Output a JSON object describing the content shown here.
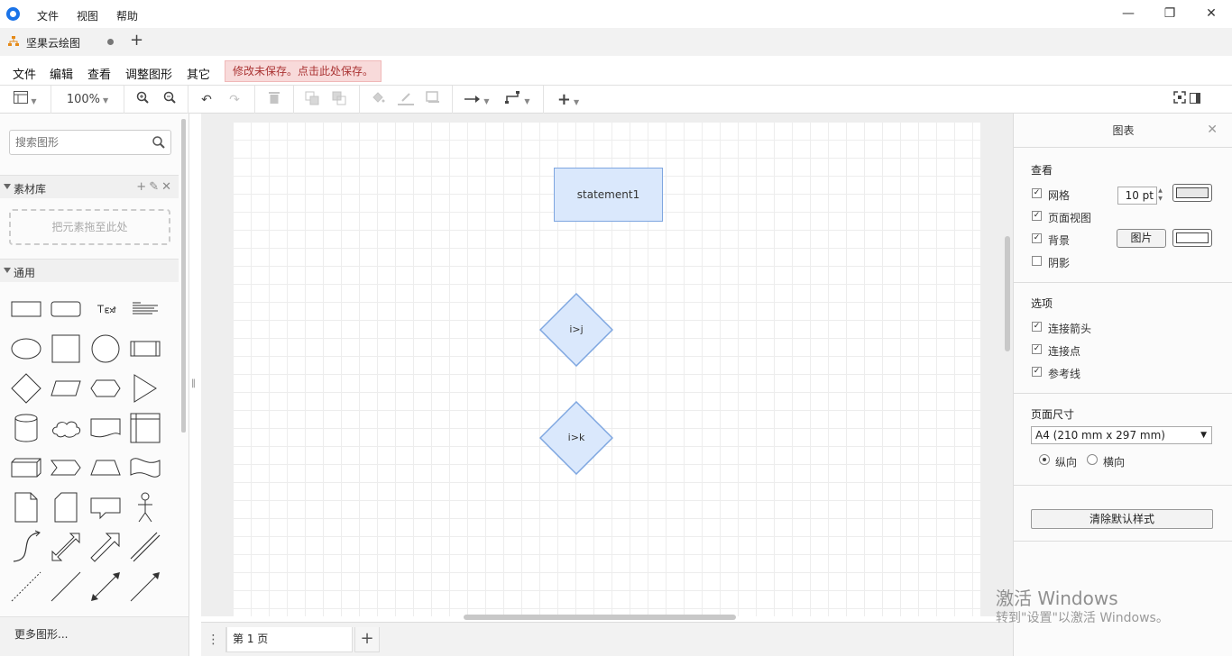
{
  "titlebar": {
    "menus": [
      "文件",
      "视图",
      "帮助"
    ],
    "minimize": "—",
    "restore": "❐",
    "close": "✕"
  },
  "tabbar": {
    "doc_title": "坚果云绘图",
    "new_tab": "+"
  },
  "menubar": {
    "items": [
      "文件",
      "编辑",
      "查看",
      "调整图形",
      "其它"
    ],
    "unsaved_notice": "修改未保存。点击此处保存。"
  },
  "toolbar": {
    "zoom": "100%"
  },
  "sidebar": {
    "search_placeholder": "搜索图形",
    "library_title": "素材库",
    "drop_zone": "把元素拖至此处",
    "general_title": "通用",
    "more_shapes": "更多图形..."
  },
  "canvas": {
    "nodes": [
      {
        "label": "statement1"
      },
      {
        "label": "i>j"
      },
      {
        "label": "i>k"
      }
    ]
  },
  "pagebar": {
    "page_name": "第 1 页",
    "menu": "⋮",
    "add": "+"
  },
  "panel": {
    "title": "图表",
    "view_title": "查看",
    "grid": "网格",
    "grid_size": "10 pt",
    "page_view": "页面视图",
    "background": "背景",
    "image_button": "图片",
    "shadow": "阴影",
    "options_title": "选项",
    "connect_arrows": "连接箭头",
    "connect_points": "连接点",
    "guides": "参考线",
    "page_size_title": "页面尺寸",
    "page_size_value": "A4 (210 mm x 297 mm)",
    "portrait": "纵向",
    "landscape": "横向",
    "clear_style": "清除默认样式"
  },
  "watermark": {
    "line1": "激活 Windows",
    "line2": "转到\"设置\"以激活 Windows。"
  },
  "colors": {
    "node_fill": "#dae8fc",
    "node_stroke": "#7ea6e0",
    "unsaved_bg": "#f8dada",
    "unsaved_text": "#a33333"
  }
}
